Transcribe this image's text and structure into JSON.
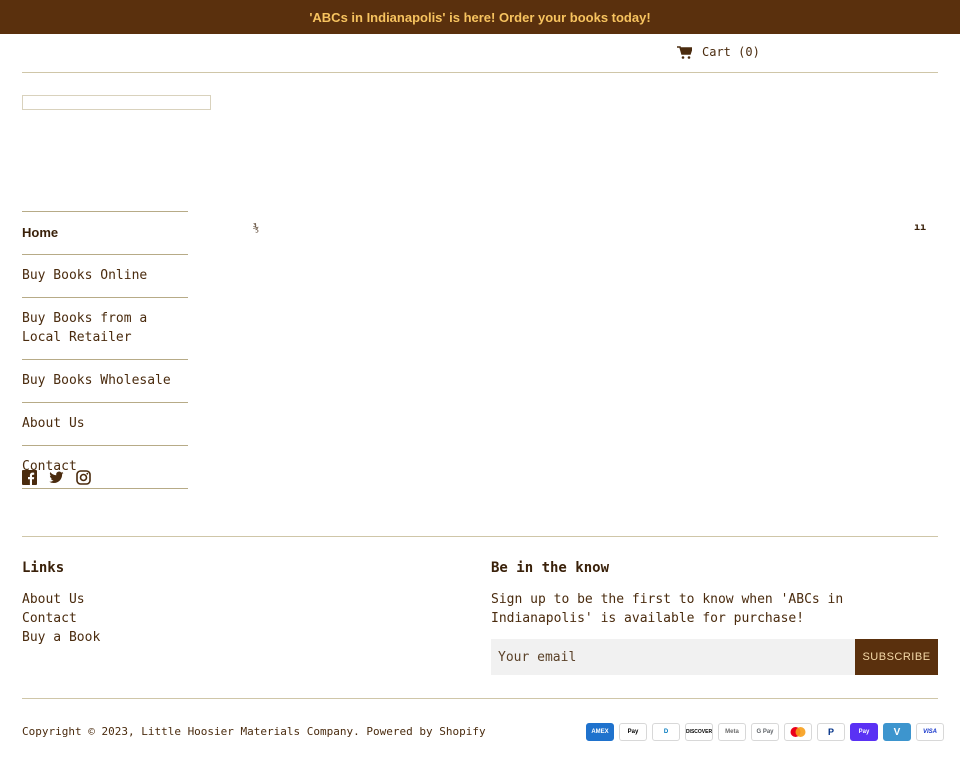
{
  "announcement": {
    "text": "'ABCs in Indianapolis' is here! Order your books today!"
  },
  "header": {
    "cart_label": "Cart",
    "cart_count": "(0)"
  },
  "nav": {
    "items": [
      {
        "label": "Home",
        "active": true
      },
      {
        "label": "Buy Books Online"
      },
      {
        "label": "Buy Books from a Local Retailer"
      },
      {
        "label": "Buy Books Wholesale"
      },
      {
        "label": "About Us"
      },
      {
        "label": "Contact"
      }
    ]
  },
  "social": [
    "facebook-icon",
    "twitter-icon",
    "instagram-icon"
  ],
  "slideshow": {
    "prev_symbol": "⅗",
    "pause_symbol": "ıı"
  },
  "footer": {
    "links_heading": "Links",
    "links": [
      "About Us",
      "Contact",
      "Buy a Book"
    ],
    "newsletter_heading": "Be in the know",
    "newsletter_text": "Sign up to be the first to know when 'ABCs in Indianapolis' is available for purchase!",
    "email_placeholder": "Your email",
    "subscribe_label": "SUBSCRIBE",
    "copyright": "Copyright © 2023, Little Hoosier Materials Company. Powered by Shopify",
    "payments": [
      "AMEX",
      "Pay",
      "D",
      "DISCOVER",
      "Meta",
      "G Pay",
      "MC",
      "P",
      "Pay",
      "V",
      "VISA"
    ]
  },
  "colors": {
    "brand": "#5a300d",
    "accent": "#f7c35f",
    "text": "#4a2b0e"
  }
}
